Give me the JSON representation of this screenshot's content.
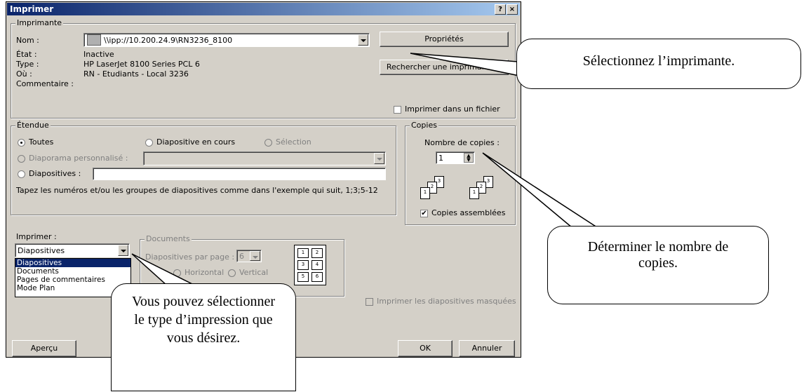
{
  "window": {
    "title": "Imprimer",
    "help_btn": "?",
    "close_btn": "×"
  },
  "printer": {
    "group_label": "Imprimante",
    "name_label": "Nom :",
    "name_value": "\\\\ipp://10.200.24.9\\RN3236_8100",
    "etat_label": "État :",
    "etat_value": "Inactive",
    "type_label": "Type :",
    "type_value": "HP LaserJet 8100 Series PCL 6",
    "ou_label": "Où :",
    "ou_value": "RN - Etudiants - Local 3236",
    "comment_label": "Commentaire :",
    "properties_btn": "Propriétés",
    "find_btn": "Rechercher une imprimante...",
    "print_to_file": "Imprimer dans un fichier"
  },
  "range": {
    "group_label": "Étendue",
    "all": "Toutes",
    "current": "Diapositive en cours",
    "selection": "Sélection",
    "custom_show": "Diaporama personnalisé :",
    "slides": "Diapositives :",
    "hint": "Tapez les numéros et/ou les groupes de diapositives comme dans l'exemple qui suit, 1;3;5-12"
  },
  "copies": {
    "group_label": "Copies",
    "count_label": "Nombre de copies :",
    "count_value": "1",
    "collate": "Copies assemblées"
  },
  "print_what": {
    "label": "Imprimer :",
    "value": "Diapositives",
    "options": [
      "Diapositives",
      "Documents",
      "Pages de commentaires",
      "Mode Plan"
    ]
  },
  "handouts": {
    "group_label": "Documents",
    "per_page_label": "Diapositives par page :",
    "per_page_value": "6",
    "horizontal": "Horizontal",
    "vertical": "Vertical",
    "order_nums": [
      "1",
      "2",
      "3",
      "4",
      "5",
      "6"
    ]
  },
  "options": {
    "hidden_slides": "Imprimer les diapositives masquées"
  },
  "buttons": {
    "preview": "Aperçu",
    "ok": "OK",
    "cancel": "Annuler"
  },
  "callouts": {
    "printer": "Sélectionnez l’imprimante.",
    "copies": "Déterminer le nombre de copies.",
    "type": "Vous pouvez sélectionner le type d’impression que vous désirez."
  }
}
